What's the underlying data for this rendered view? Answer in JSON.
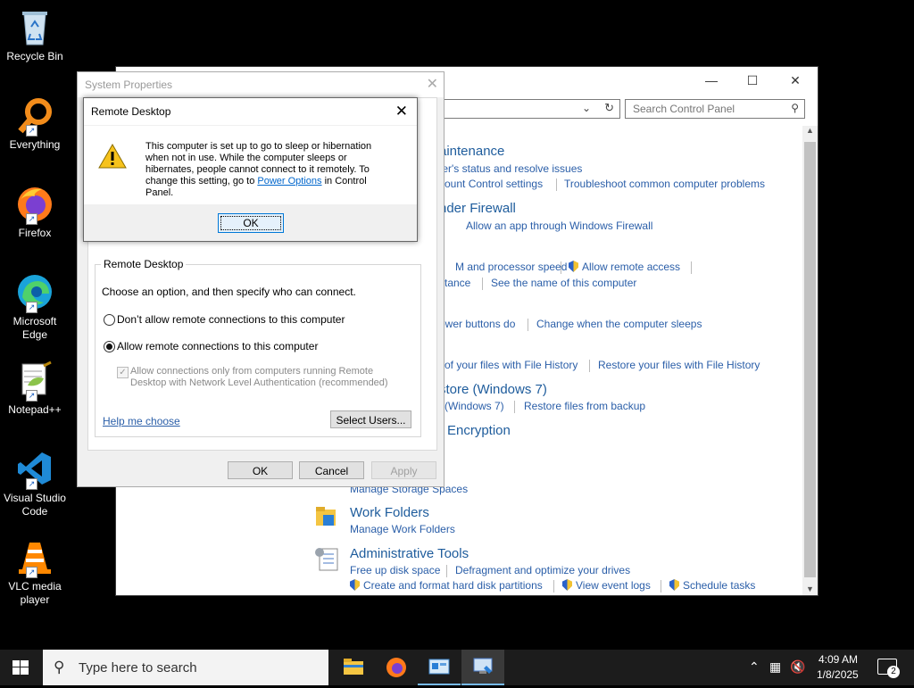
{
  "desktop": {
    "icons": [
      {
        "label": "Recycle Bin"
      },
      {
        "label": "Everything"
      },
      {
        "label": "Firefox"
      },
      {
        "label": "Microsoft Edge"
      },
      {
        "label": "Notepad++"
      },
      {
        "label": "Visual Studio Code"
      },
      {
        "label": "VLC media player"
      }
    ]
  },
  "control_panel": {
    "search_placeholder": "Search Control Panel",
    "categories": [
      {
        "title": "aintenance",
        "links": [
          "ter's status and resolve issues",
          "count Control settings",
          "Troubleshoot common computer problems"
        ]
      },
      {
        "title": "nder Firewall",
        "links": [
          "Allow an app through Windows Firewall"
        ]
      },
      {
        "title": "",
        "links": [
          "M and processor speed",
          "Allow remote access",
          "stance",
          "See the name of this computer"
        ]
      },
      {
        "title": "",
        "links": [
          "ower buttons do",
          "Change when the computer sleeps"
        ]
      },
      {
        "title": "",
        "links": [
          "of your files with File History",
          "Restore your files with File History"
        ]
      },
      {
        "title": "store (Windows 7)",
        "links": [
          "(Windows 7)",
          "Restore files from backup"
        ]
      },
      {
        "title": "Encryption",
        "links": []
      },
      {
        "title": "",
        "links": [
          "Manage Storage Spaces"
        ]
      },
      {
        "title": "Work Folders",
        "links": [
          "Manage Work Folders"
        ]
      },
      {
        "title": "Administrative Tools",
        "links": [
          "Free up disk space",
          "Defragment and optimize your drives",
          "Create and format hard disk partitions",
          "View event logs",
          "Schedule tasks"
        ]
      }
    ]
  },
  "system_properties": {
    "title": "System Properties",
    "group_title": "Remote Desktop",
    "instruction": "Choose an option, and then specify who can connect.",
    "option_deny": "Don’t allow remote connections to this computer",
    "option_allow": "Allow remote connections to this computer",
    "nla_label": "Allow connections only from computers running Remote Desktop with Network Level Authentication (recommended)",
    "help_link": "Help me choose",
    "select_users": "Select Users...",
    "ok": "OK",
    "cancel": "Cancel",
    "apply": "Apply"
  },
  "message_box": {
    "title": "Remote Desktop",
    "text_before": "This computer is set up to go to sleep or hibernation when not in use. While the computer sleeps or hibernates, people cannot connect to it remotely. To change this setting, go to",
    "link": "Power Options",
    "text_after": "in Control Panel.",
    "ok": "OK"
  },
  "taskbar": {
    "search_placeholder": "Type here to search",
    "time": "4:09 AM",
    "date": "1/8/2025",
    "notification_count": "2"
  }
}
